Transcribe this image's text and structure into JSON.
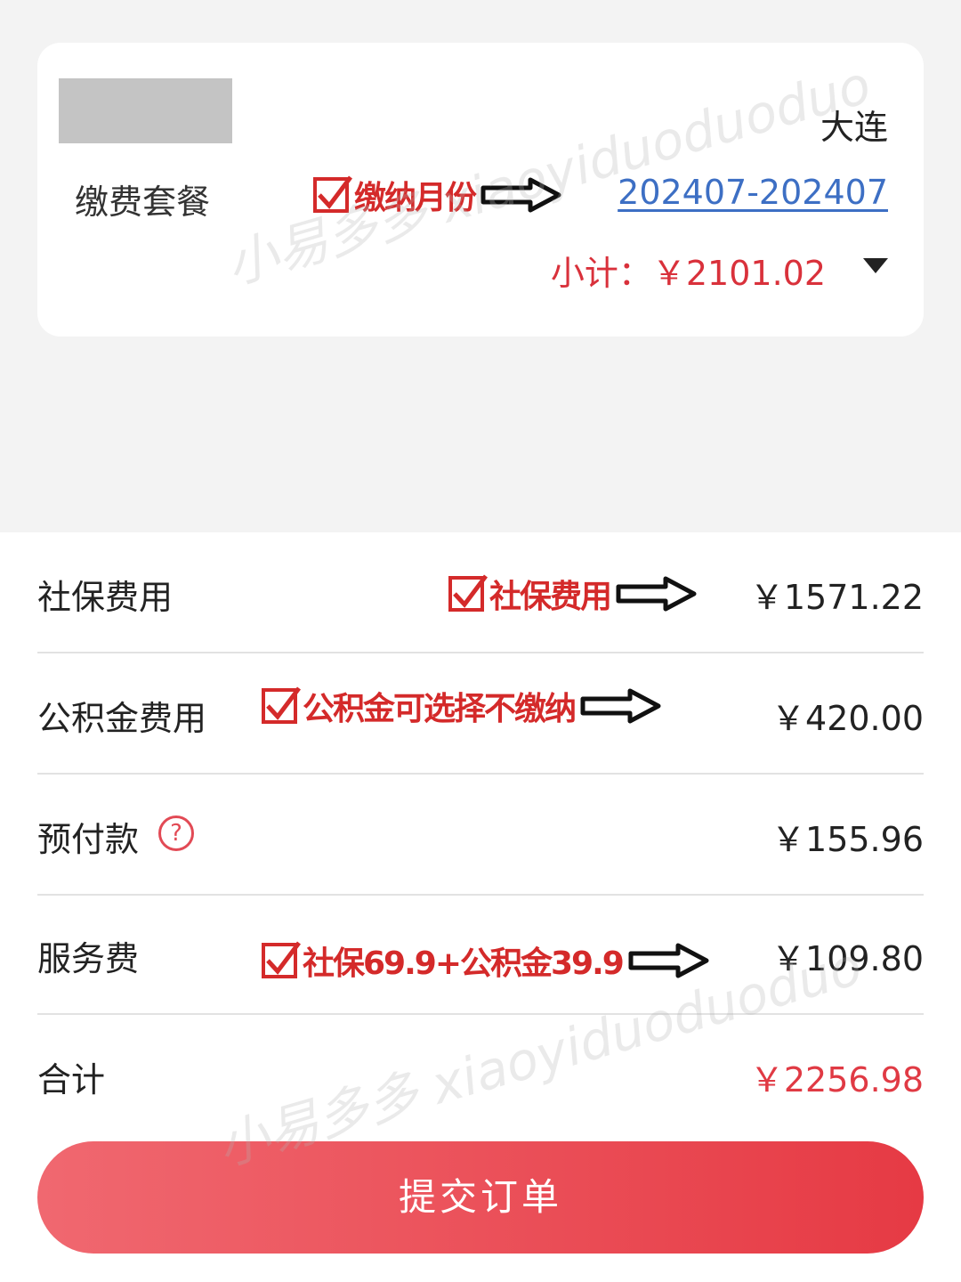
{
  "card": {
    "city": "大连",
    "plan_label": "缴费套餐",
    "months": "202407-202407",
    "subtotal": "小计：￥2101.02"
  },
  "rows": [
    {
      "label": "社保费用",
      "value": "￥1571.22"
    },
    {
      "label": "公积金费用",
      "value": "￥420.00"
    },
    {
      "label": "预付款",
      "value": "￥155.96"
    },
    {
      "label": "服务费",
      "value": "￥109.80"
    },
    {
      "label": "合计",
      "value": "￥2256.98"
    }
  ],
  "annotations": {
    "months": "缴纳月份",
    "social": "社保费用",
    "fund": "公积金可选择不缴纳",
    "service": "社保69.9+公积金39.9"
  },
  "help_icon_glyph": "?",
  "submit_label": "提交订单",
  "watermark": "小易多多 xiaoyiduoduoduo",
  "colors": {
    "accent": "#e63a44",
    "link": "#3d6fc4",
    "annotation": "#d42a2a"
  }
}
